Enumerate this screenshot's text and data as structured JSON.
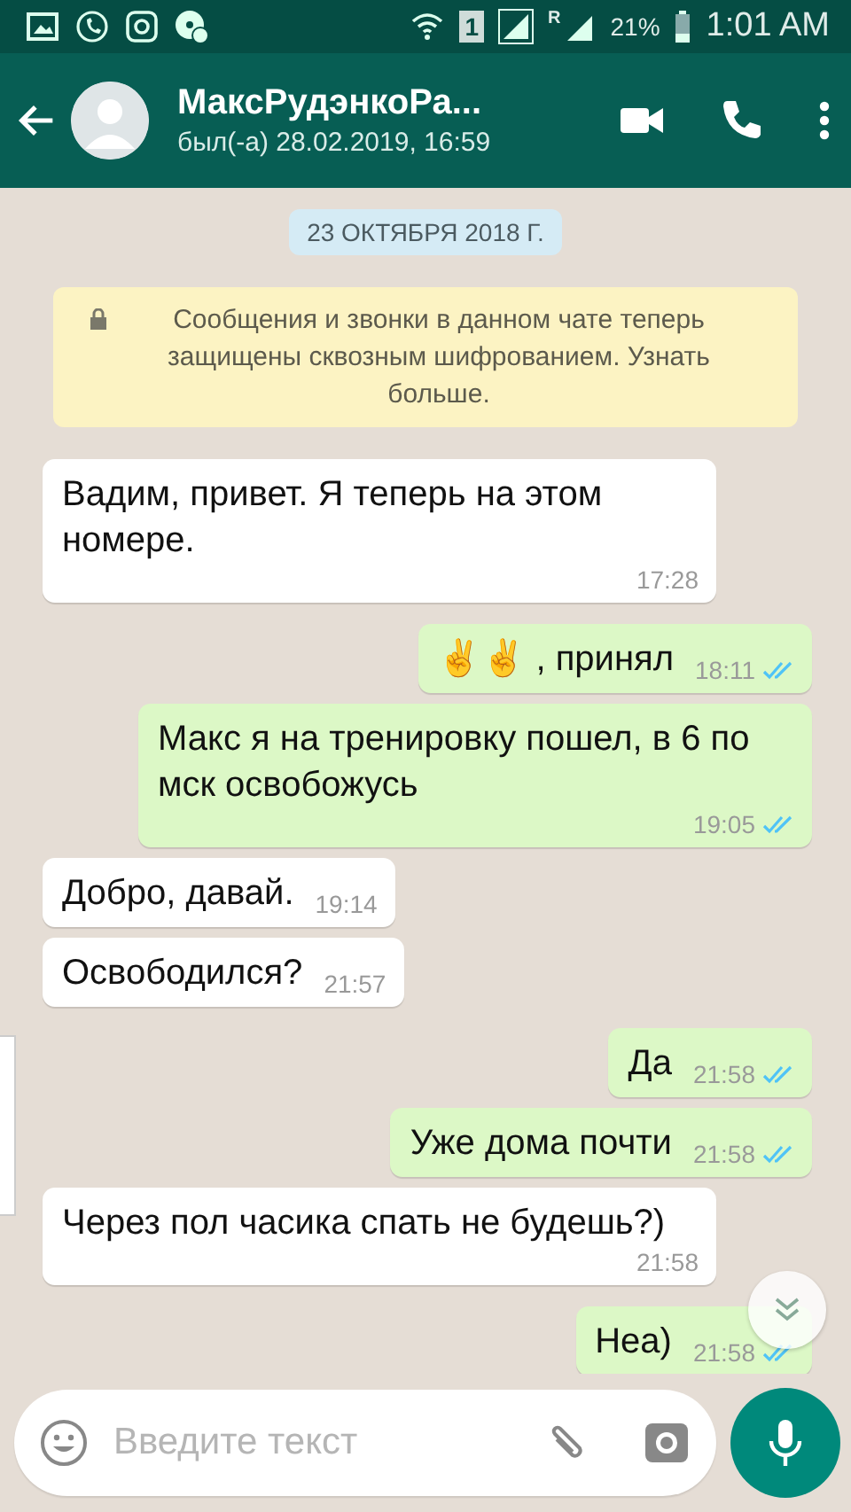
{
  "status_bar": {
    "sim": "1",
    "roaming": "R",
    "battery": "21%",
    "time": "1:01 AM"
  },
  "header": {
    "title": "МаксРудэнкоРа...",
    "subtitle": "был(-а) 28.02.2019, 16:59"
  },
  "date_chip": "23 ОКТЯБРЯ 2018 Г.",
  "notice": "Сообщения и звонки в данном чате теперь защищены сквозным шифрованием. Узнать больше.",
  "messages": [
    {
      "kind": "in",
      "text": "Вадим, привет. Я теперь на этом номере.",
      "time": "17:28"
    },
    {
      "kind": "out",
      "text": "✌✌ , принял",
      "time": "18:11",
      "read": true
    },
    {
      "kind": "out",
      "text": "Макс я на тренировку пошел, в 6 по мск освобожусь",
      "time": "19:05",
      "read": true
    },
    {
      "kind": "in",
      "text": "Добро, давай.",
      "time": "19:14"
    },
    {
      "kind": "in",
      "text": "Освободился?",
      "time": "21:57"
    },
    {
      "kind": "out",
      "text": "Да",
      "time": "21:58",
      "read": true
    },
    {
      "kind": "out",
      "text": "Уже дома почти",
      "time": "21:58",
      "read": true
    },
    {
      "kind": "in",
      "text": "Через пол часика спать не будешь?)",
      "time": "21:58"
    },
    {
      "kind": "out",
      "text": "Неа)",
      "time": "21:58",
      "read": true
    }
  ],
  "composer": {
    "placeholder": "Введите текст"
  }
}
